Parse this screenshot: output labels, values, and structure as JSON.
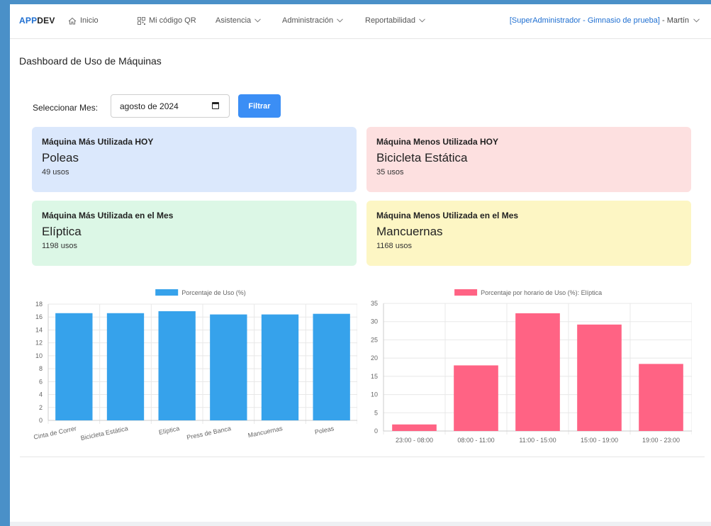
{
  "navbar": {
    "brand_accent": "APP",
    "brand_rest": "DEV",
    "items": [
      {
        "label": "Inicio",
        "icon": "home-icon"
      },
      {
        "label": "Mi código QR",
        "icon": "qr-icon"
      },
      {
        "label": "Asistencia",
        "icon": "chevron-down-icon"
      },
      {
        "label": "Administración",
        "icon": "chevron-down-icon"
      },
      {
        "label": "Reportabilidad",
        "icon": "chevron-down-icon"
      }
    ],
    "user_role": "[SuperAdministrador - Gimnasio de prueba]",
    "user_name": " - Martín"
  },
  "page": {
    "title": "Dashboard de Uso de Máquinas"
  },
  "filter": {
    "label": "Seleccionar Mes:",
    "month_value": "agosto de 2024",
    "button_label": "Filtrar"
  },
  "cards": [
    {
      "title": "Máquina Más Utilizada HOY",
      "machine": "Poleas",
      "uses": "49 usos",
      "color": "#dbe8fc"
    },
    {
      "title": "Máquina Menos Utilizada HOY",
      "machine": "Bicicleta Estática",
      "uses": "35 usos",
      "color": "#fde0e0"
    },
    {
      "title": "Máquina Más Utilizada en el Mes",
      "machine": "Elíptica",
      "uses": "1198 usos",
      "color": "#dcf7e6"
    },
    {
      "title": "Máquina Menos Utilizada en el Mes",
      "machine": "Mancuernas",
      "uses": "1168 usos",
      "color": "#fdf6c4"
    }
  ],
  "chart_data": [
    {
      "type": "bar",
      "categories": [
        "Cinta de Correr",
        "Bicicleta Estática",
        "Elíptica",
        "Press de Banca",
        "Mancuernas",
        "Poleas"
      ],
      "series": [
        {
          "name": "Porcentaje de Uso (%)",
          "values": [
            16.6,
            16.6,
            16.9,
            16.4,
            16.4,
            16.5
          ],
          "color": "#36a2eb"
        }
      ],
      "ylim": [
        0,
        18
      ],
      "yticks": [
        0,
        2,
        4,
        6,
        8,
        10,
        12,
        14,
        16,
        18
      ],
      "grid": true,
      "legend": "top",
      "xlabel_rotation": "slanted"
    },
    {
      "type": "bar",
      "categories": [
        "23:00 - 08:00",
        "08:00 - 11:00",
        "11:00 - 15:00",
        "15:00 - 19:00",
        "19:00 - 23:00"
      ],
      "series": [
        {
          "name": "Porcentaje por horario de Uso (%): Elíptica",
          "values": [
            1.8,
            18,
            32.3,
            29.2,
            18.4
          ],
          "color": "#ff6384"
        }
      ],
      "ylim": [
        0,
        35
      ],
      "yticks": [
        0,
        5,
        10,
        15,
        20,
        25,
        30,
        35
      ],
      "grid": true,
      "legend": "top"
    }
  ]
}
